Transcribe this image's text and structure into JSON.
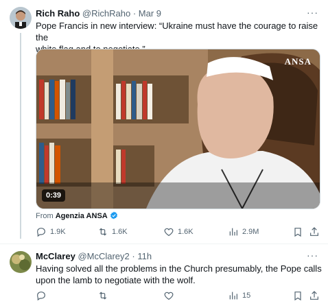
{
  "tweet1": {
    "name": "Rich Raho",
    "handle": "@RichRaho",
    "separator": "·",
    "date": "Mar 9",
    "text_line1": "Pope Francis in new interview: “Ukraine must have the courage to raise the",
    "text_line2": "white flag and to negotiate.”",
    "video": {
      "duration": "0:39",
      "watermark": "ANSA"
    },
    "source_prefix": "From",
    "source_name": "Agenzia ANSA",
    "stats": {
      "replies": "1.9K",
      "reposts": "1.6K",
      "likes": "1.6K",
      "views": "2.9M"
    }
  },
  "tweet2": {
    "name": "McClarey",
    "handle": "@McClarey2",
    "separator": "·",
    "date": "11h",
    "text_line1": "Having solved all the problems in the Church presumably, the Pope calls",
    "text_line2": "upon the lamb to negotiate with the wolf.",
    "stats": {
      "views": "15"
    }
  },
  "icons": {
    "more": "more-icon",
    "reply": "reply-icon",
    "repost": "repost-icon",
    "like": "like-icon",
    "views": "views-icon",
    "bookmark": "bookmark-icon",
    "share": "share-icon",
    "verified": "verified-icon"
  },
  "colors": {
    "text": "#0f1419",
    "secondary": "#536471",
    "accent": "#1d9bf0",
    "border": "#cfd9de"
  },
  "more_glyph": "···"
}
